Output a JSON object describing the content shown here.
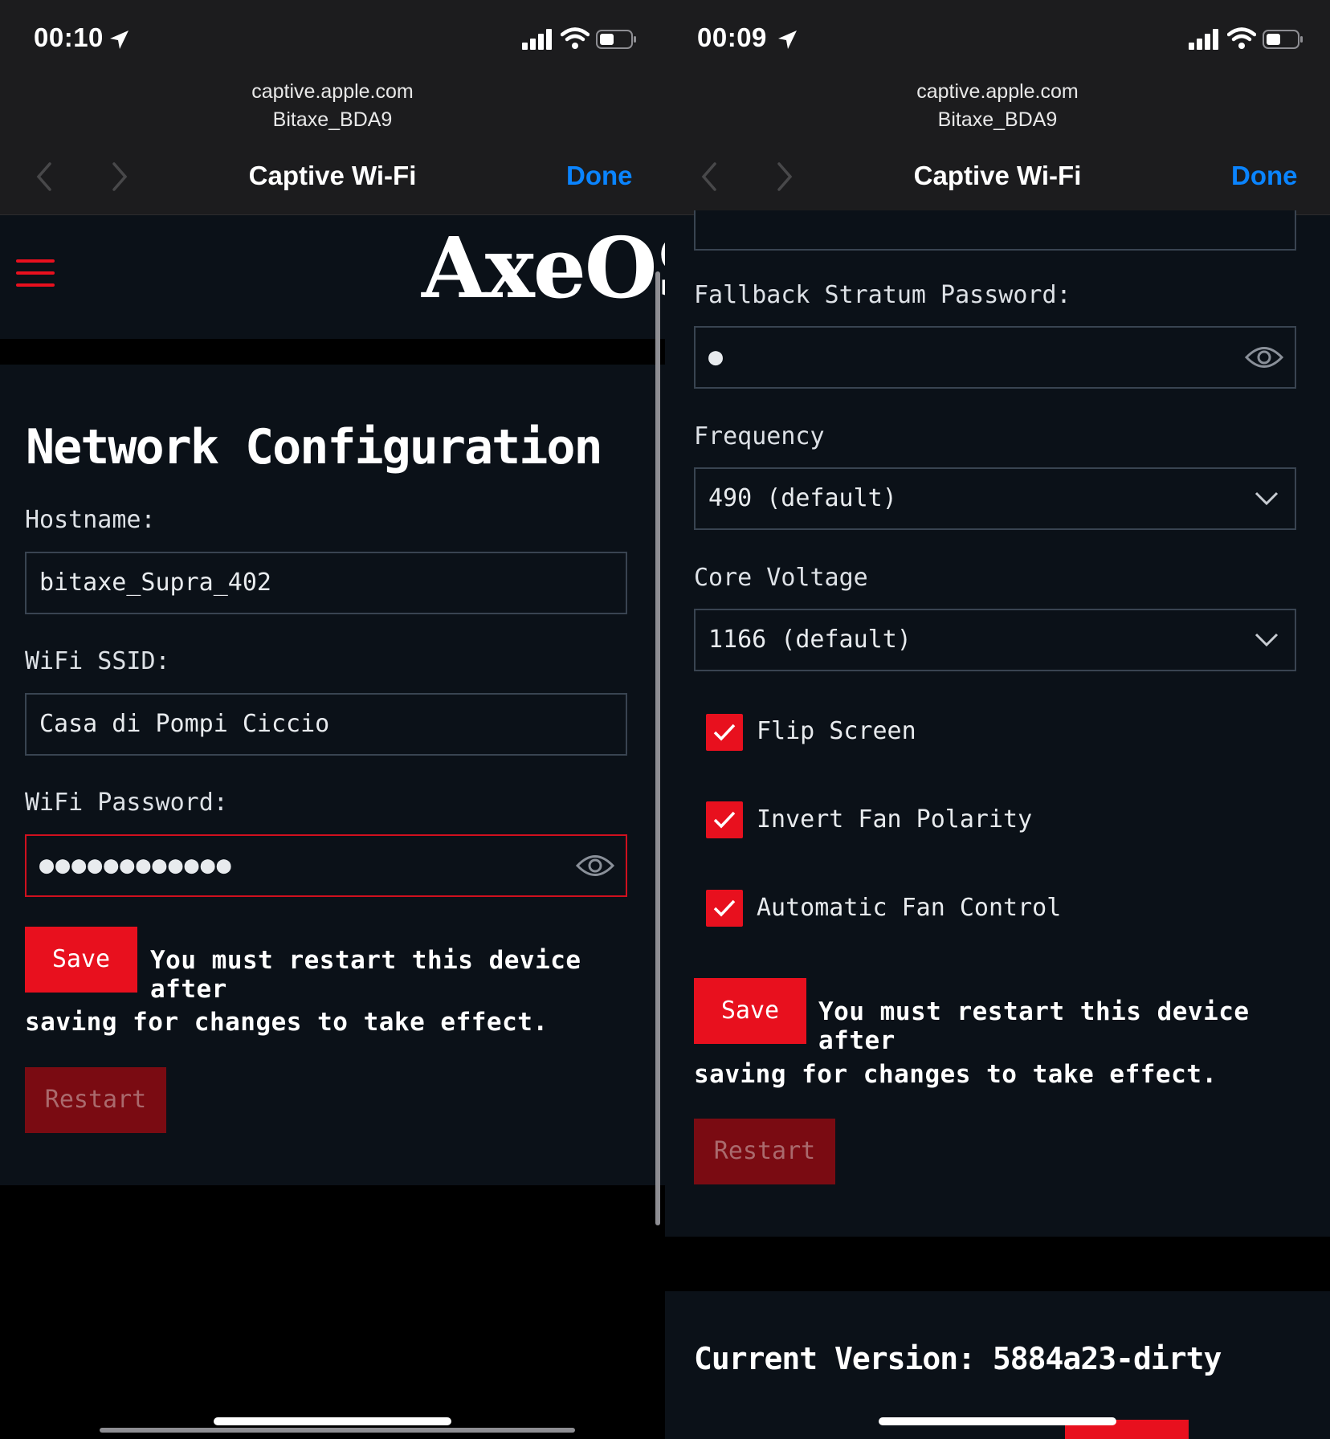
{
  "left": {
    "status": {
      "time": "00:10"
    },
    "browser": {
      "url": "captive.apple.com",
      "network": "Bitaxe_BDA9",
      "title": "Captive Wi-Fi",
      "done": "Done"
    },
    "app": {
      "logo": "AxeOS",
      "page_title": "Network Configuration",
      "hostname_label": "Hostname:",
      "hostname_value": "bitaxe_Supra_402",
      "ssid_label": "WiFi SSID:",
      "ssid_value": "Casa di Pompi Ciccio",
      "password_label": "WiFi Password:",
      "password_value": "●●●●●●●●●●●●",
      "save": "Save",
      "restart_note_1": "You must restart this device after",
      "restart_note_2": "saving for changes to take effect.",
      "restart": "Restart"
    }
  },
  "right": {
    "status": {
      "time": "00:09"
    },
    "browser": {
      "url": "captive.apple.com",
      "network": "Bitaxe_BDA9",
      "title": "Captive Wi-Fi",
      "done": "Done"
    },
    "app": {
      "fallback_password_label": "Fallback Stratum Password:",
      "fallback_password_value": "●",
      "frequency_label": "Frequency",
      "frequency_value": "490 (default)",
      "voltage_label": "Core Voltage",
      "voltage_value": "1166 (default)",
      "checkboxes": [
        {
          "label": "Flip Screen",
          "checked": true
        },
        {
          "label": "Invert Fan Polarity",
          "checked": true
        },
        {
          "label": "Automatic Fan Control",
          "checked": true
        }
      ],
      "save": "Save",
      "restart_note_1": "You must restart this device after",
      "restart_note_2": "saving for changes to take effect.",
      "restart": "Restart",
      "version": "Current Version: 5884a23-dirty"
    }
  },
  "colors": {
    "accent": "#e8101e",
    "ios_blue": "#0a84ff",
    "panel_bg": "#0b1118",
    "chrome_bg": "#1c1c1e"
  }
}
